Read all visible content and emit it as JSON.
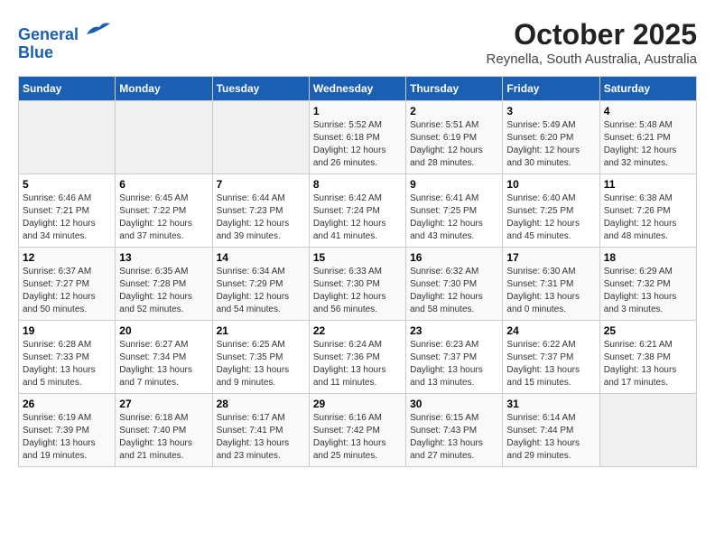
{
  "header": {
    "logo_line1": "General",
    "logo_line2": "Blue",
    "title": "October 2025",
    "subtitle": "Reynella, South Australia, Australia"
  },
  "weekdays": [
    "Sunday",
    "Monday",
    "Tuesday",
    "Wednesday",
    "Thursday",
    "Friday",
    "Saturday"
  ],
  "weeks": [
    [
      {
        "day": "",
        "info": ""
      },
      {
        "day": "",
        "info": ""
      },
      {
        "day": "",
        "info": ""
      },
      {
        "day": "1",
        "info": "Sunrise: 5:52 AM\nSunset: 6:18 PM\nDaylight: 12 hours\nand 26 minutes."
      },
      {
        "day": "2",
        "info": "Sunrise: 5:51 AM\nSunset: 6:19 PM\nDaylight: 12 hours\nand 28 minutes."
      },
      {
        "day": "3",
        "info": "Sunrise: 5:49 AM\nSunset: 6:20 PM\nDaylight: 12 hours\nand 30 minutes."
      },
      {
        "day": "4",
        "info": "Sunrise: 5:48 AM\nSunset: 6:21 PM\nDaylight: 12 hours\nand 32 minutes."
      }
    ],
    [
      {
        "day": "5",
        "info": "Sunrise: 6:46 AM\nSunset: 7:21 PM\nDaylight: 12 hours\nand 34 minutes."
      },
      {
        "day": "6",
        "info": "Sunrise: 6:45 AM\nSunset: 7:22 PM\nDaylight: 12 hours\nand 37 minutes."
      },
      {
        "day": "7",
        "info": "Sunrise: 6:44 AM\nSunset: 7:23 PM\nDaylight: 12 hours\nand 39 minutes."
      },
      {
        "day": "8",
        "info": "Sunrise: 6:42 AM\nSunset: 7:24 PM\nDaylight: 12 hours\nand 41 minutes."
      },
      {
        "day": "9",
        "info": "Sunrise: 6:41 AM\nSunset: 7:25 PM\nDaylight: 12 hours\nand 43 minutes."
      },
      {
        "day": "10",
        "info": "Sunrise: 6:40 AM\nSunset: 7:25 PM\nDaylight: 12 hours\nand 45 minutes."
      },
      {
        "day": "11",
        "info": "Sunrise: 6:38 AM\nSunset: 7:26 PM\nDaylight: 12 hours\nand 48 minutes."
      }
    ],
    [
      {
        "day": "12",
        "info": "Sunrise: 6:37 AM\nSunset: 7:27 PM\nDaylight: 12 hours\nand 50 minutes."
      },
      {
        "day": "13",
        "info": "Sunrise: 6:35 AM\nSunset: 7:28 PM\nDaylight: 12 hours\nand 52 minutes."
      },
      {
        "day": "14",
        "info": "Sunrise: 6:34 AM\nSunset: 7:29 PM\nDaylight: 12 hours\nand 54 minutes."
      },
      {
        "day": "15",
        "info": "Sunrise: 6:33 AM\nSunset: 7:30 PM\nDaylight: 12 hours\nand 56 minutes."
      },
      {
        "day": "16",
        "info": "Sunrise: 6:32 AM\nSunset: 7:30 PM\nDaylight: 12 hours\nand 58 minutes."
      },
      {
        "day": "17",
        "info": "Sunrise: 6:30 AM\nSunset: 7:31 PM\nDaylight: 13 hours\nand 0 minutes."
      },
      {
        "day": "18",
        "info": "Sunrise: 6:29 AM\nSunset: 7:32 PM\nDaylight: 13 hours\nand 3 minutes."
      }
    ],
    [
      {
        "day": "19",
        "info": "Sunrise: 6:28 AM\nSunset: 7:33 PM\nDaylight: 13 hours\nand 5 minutes."
      },
      {
        "day": "20",
        "info": "Sunrise: 6:27 AM\nSunset: 7:34 PM\nDaylight: 13 hours\nand 7 minutes."
      },
      {
        "day": "21",
        "info": "Sunrise: 6:25 AM\nSunset: 7:35 PM\nDaylight: 13 hours\nand 9 minutes."
      },
      {
        "day": "22",
        "info": "Sunrise: 6:24 AM\nSunset: 7:36 PM\nDaylight: 13 hours\nand 11 minutes."
      },
      {
        "day": "23",
        "info": "Sunrise: 6:23 AM\nSunset: 7:37 PM\nDaylight: 13 hours\nand 13 minutes."
      },
      {
        "day": "24",
        "info": "Sunrise: 6:22 AM\nSunset: 7:37 PM\nDaylight: 13 hours\nand 15 minutes."
      },
      {
        "day": "25",
        "info": "Sunrise: 6:21 AM\nSunset: 7:38 PM\nDaylight: 13 hours\nand 17 minutes."
      }
    ],
    [
      {
        "day": "26",
        "info": "Sunrise: 6:19 AM\nSunset: 7:39 PM\nDaylight: 13 hours\nand 19 minutes."
      },
      {
        "day": "27",
        "info": "Sunrise: 6:18 AM\nSunset: 7:40 PM\nDaylight: 13 hours\nand 21 minutes."
      },
      {
        "day": "28",
        "info": "Sunrise: 6:17 AM\nSunset: 7:41 PM\nDaylight: 13 hours\nand 23 minutes."
      },
      {
        "day": "29",
        "info": "Sunrise: 6:16 AM\nSunset: 7:42 PM\nDaylight: 13 hours\nand 25 minutes."
      },
      {
        "day": "30",
        "info": "Sunrise: 6:15 AM\nSunset: 7:43 PM\nDaylight: 13 hours\nand 27 minutes."
      },
      {
        "day": "31",
        "info": "Sunrise: 6:14 AM\nSunset: 7:44 PM\nDaylight: 13 hours\nand 29 minutes."
      },
      {
        "day": "",
        "info": ""
      }
    ]
  ]
}
